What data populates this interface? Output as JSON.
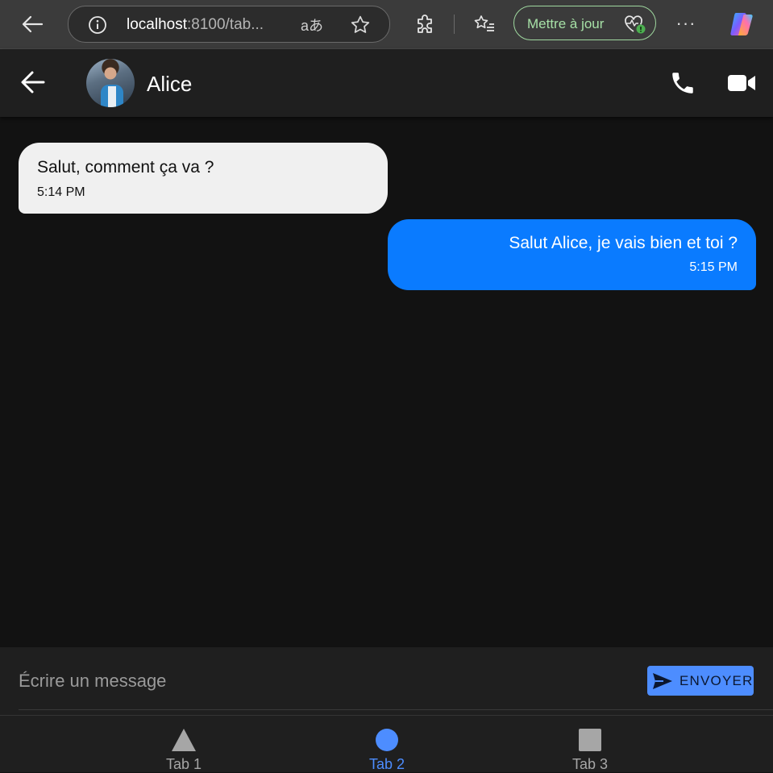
{
  "browser": {
    "url_host": "localhost",
    "url_rest": ":8100/tab...",
    "translate_glyph": "aあ",
    "update_label": "Mettre à jour",
    "more_glyph": "···"
  },
  "chat": {
    "contact_name": "Alice",
    "messages": [
      {
        "direction": "incoming",
        "text": "Salut, comment ça va ?",
        "time": "5:14 PM"
      },
      {
        "direction": "outgoing",
        "text": "Salut Alice, je vais bien et toi ?",
        "time": "5:15 PM"
      }
    ]
  },
  "composer": {
    "placeholder": "Écrire un message",
    "value": "",
    "send_label": "ENVOYER"
  },
  "tabs": [
    {
      "label": "Tab 1",
      "icon": "triangle-icon",
      "active": false
    },
    {
      "label": "Tab 2",
      "icon": "circle-icon",
      "active": true
    },
    {
      "label": "Tab 3",
      "icon": "square-icon",
      "active": false
    }
  ],
  "colors": {
    "accent": "#4d8dff",
    "outgoing_bubble": "#0a7bff",
    "incoming_bubble": "#f0f0f0",
    "background": "#121212",
    "toolbar": "#1f1f1f",
    "update_green": "#a6e0a6"
  }
}
